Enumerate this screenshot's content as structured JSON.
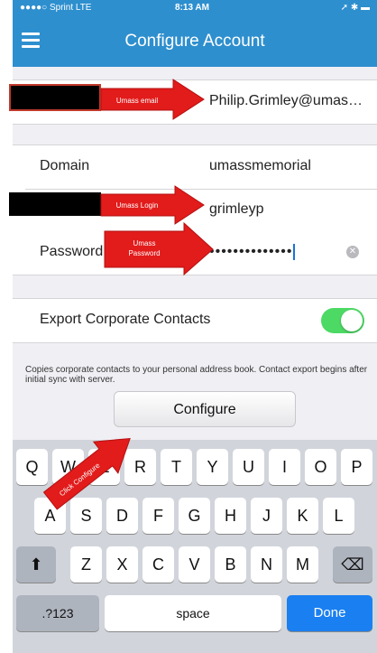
{
  "status_bar": {
    "carrier": "●●●●○ Sprint  LTE",
    "time": "8:13 AM",
    "right": "➚ ✱ ▬"
  },
  "nav": {
    "title": "Configure Account"
  },
  "fields": {
    "email": {
      "value": "Philip.Grimley@umas…"
    },
    "domain": {
      "label": "Domain",
      "value": "umassmemorial"
    },
    "login": {
      "value": "grimleyp"
    },
    "password": {
      "label": "Password",
      "value": "••••••••••••••"
    }
  },
  "export": {
    "label": "Export Corporate Contacts",
    "on": true,
    "note": "Copies corporate contacts to your personal address book. Contact export begins after initial sync with server."
  },
  "configure_button": "Configure",
  "annotations": {
    "email": "Umass email",
    "login": "Umass Login",
    "password_line1": "Umass",
    "password_line2": "Password",
    "configure": "Click Configure"
  },
  "keyboard": {
    "row1": [
      "Q",
      "W",
      "E",
      "R",
      "T",
      "Y",
      "U",
      "I",
      "O",
      "P"
    ],
    "row2": [
      "A",
      "S",
      "D",
      "F",
      "G",
      "H",
      "J",
      "K",
      "L"
    ],
    "row3": [
      "Z",
      "X",
      "C",
      "V",
      "B",
      "N",
      "M"
    ],
    "numbers": ".?123",
    "space": "space",
    "done": "Done",
    "shift": "⬆",
    "delete": "⌫"
  }
}
